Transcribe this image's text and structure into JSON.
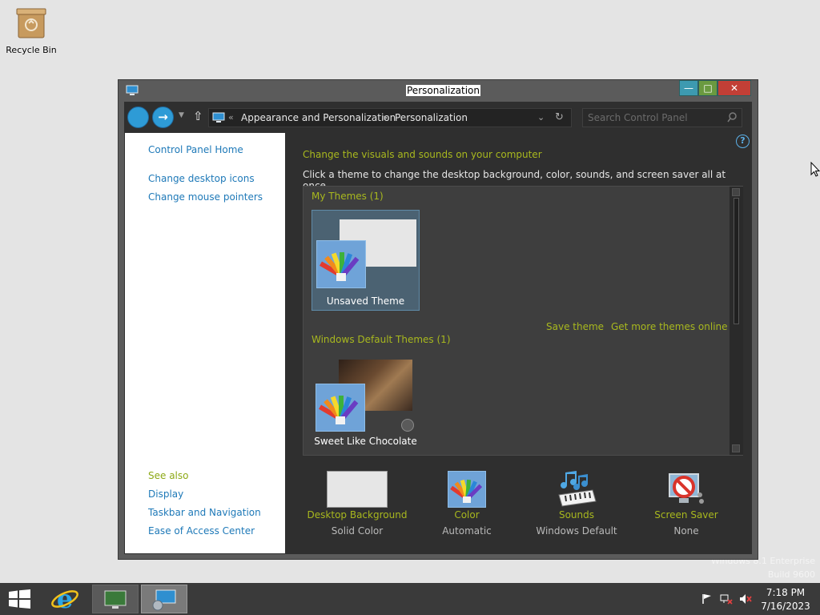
{
  "desktop": {
    "recycle_bin_label": "Recycle Bin",
    "watermark": {
      "line1": "Windows 8.1 Enterprise",
      "line2": "Build 9600"
    }
  },
  "window": {
    "title": "Personalization",
    "address": {
      "crumb1": "Appearance and Personalization",
      "crumb2": "Personalization",
      "overflow": "«"
    },
    "search_placeholder": "Search Control Panel",
    "left_pane": {
      "home": "Control Panel Home",
      "links": [
        "Change desktop icons",
        "Change mouse pointers"
      ],
      "see_also_title": "See also",
      "see_also": [
        "Display",
        "Taskbar and Navigation",
        "Ease of Access Center"
      ]
    },
    "main": {
      "heading": "Change the visuals and sounds on your computer",
      "subheading": "Click a theme to change the desktop background, color, sounds, and screen saver all at once.",
      "my_themes_title": "My Themes (1)",
      "unsaved_theme": "Unsaved Theme",
      "save_theme": "Save theme",
      "get_more": "Get more themes online",
      "default_themes_title": "Windows Default Themes (1)",
      "default_theme": "Sweet Like Chocolate",
      "settings": [
        {
          "label": "Desktop Background",
          "value": "Solid Color"
        },
        {
          "label": "Color",
          "value": "Automatic"
        },
        {
          "label": "Sounds",
          "value": "Windows Default"
        },
        {
          "label": "Screen Saver",
          "value": "None"
        }
      ]
    }
  },
  "taskbar": {
    "time": "7:18 PM",
    "date": "7/16/2023"
  },
  "colors": {
    "accent_green": "#a8b81e",
    "link_blue": "#1e79b8",
    "close_red": "#c23f36"
  }
}
